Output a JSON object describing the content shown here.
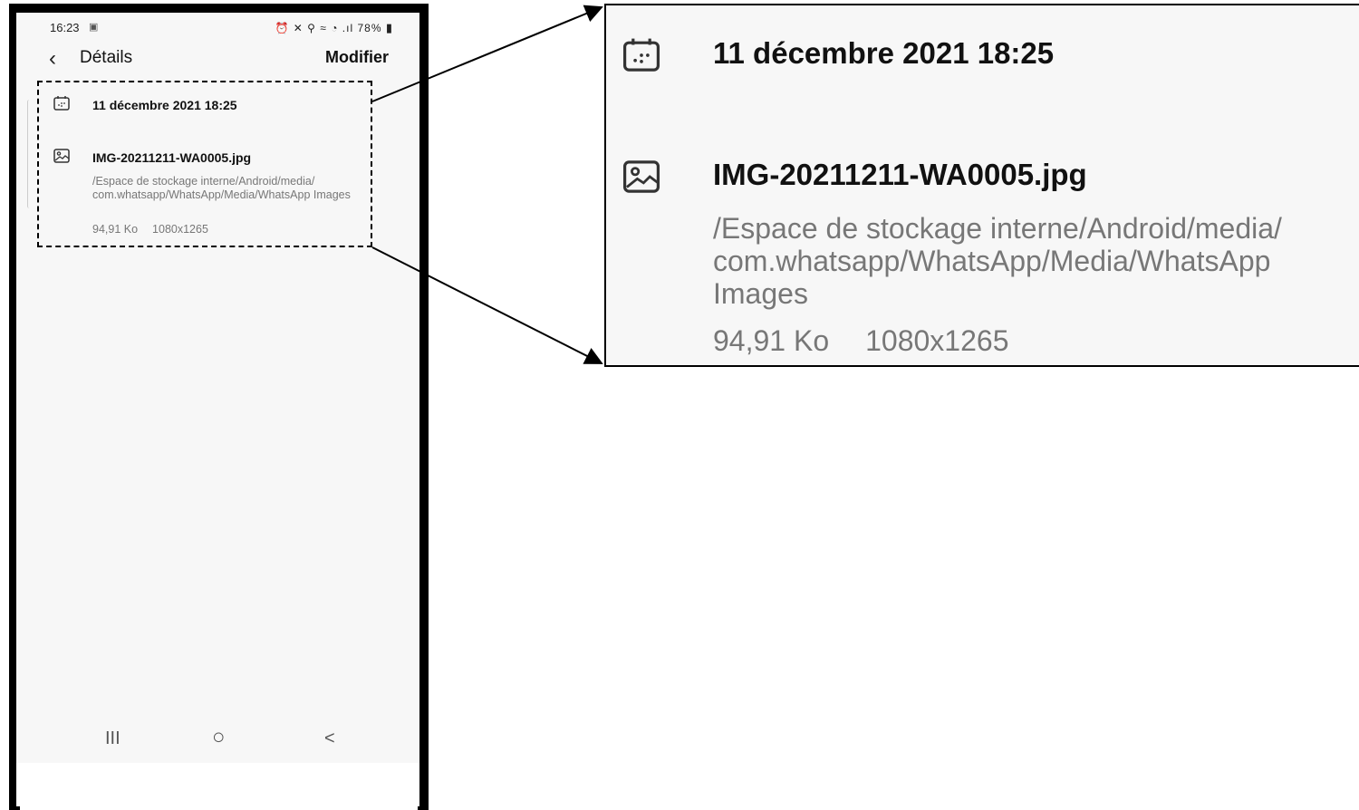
{
  "status_bar": {
    "time": "16:23",
    "right_icons": "⏰ ✕ ⚲ ≈ ◔ .ıl",
    "battery": "78%"
  },
  "app_bar": {
    "back_icon": "‹",
    "title": "Détails",
    "edit_label": "Modifier"
  },
  "details": {
    "date_icon": "calendar-icon",
    "date": "11 décembre 2021 18:25",
    "file_icon": "image-icon",
    "file_name": "IMG-20211211-WA0005.jpg",
    "path": "/Espace de stockage interne/Android/media/ com.whatsapp/WhatsApp/Media/WhatsApp Images",
    "size": "94,91 Ko",
    "resolution": "1080x1265"
  },
  "nav_bar": {
    "recents": "III",
    "home": "○",
    "back": "<"
  },
  "zoom": {
    "date": "11 décembre 2021 18:25",
    "file_name": "IMG-20211211-WA0005.jpg",
    "path": "/Espace de stockage interne/Android/media/ com.whatsapp/WhatsApp/Media/WhatsApp Images",
    "size": "94,91 Ko",
    "resolution": "1080x1265"
  }
}
